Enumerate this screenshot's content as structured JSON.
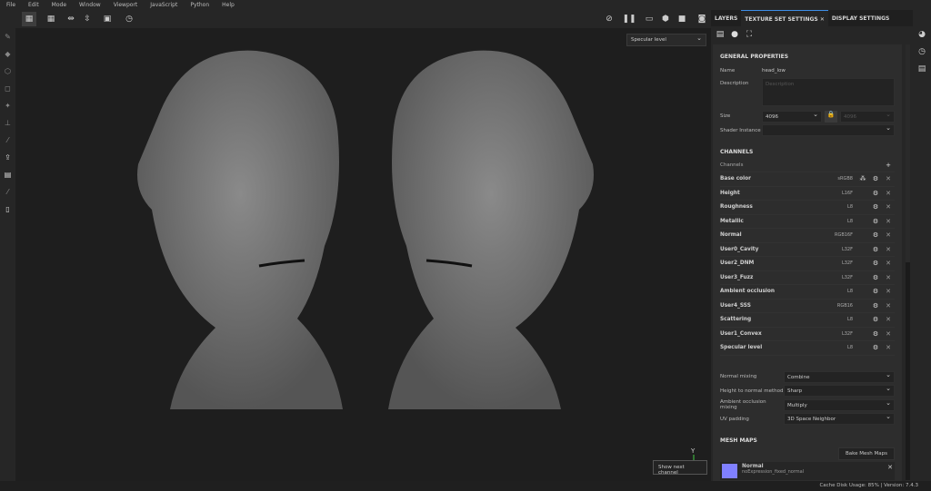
{
  "menu": [
    "File",
    "Edit",
    "Mode",
    "Window",
    "Viewport",
    "JavaScript",
    "Python",
    "Help"
  ],
  "viewport": {
    "channel_select": "Specular level",
    "tooltip": "Show next channel",
    "axis_label": "Y"
  },
  "tabs": {
    "layers": "LAYERS",
    "texture_set": "TEXTURE SET SETTINGS",
    "display": "DISPLAY SETTINGS"
  },
  "general": {
    "title": "GENERAL PROPERTIES",
    "name_label": "Name",
    "name": "head_low",
    "description_label": "Description",
    "description_placeholder": "Description",
    "size_label": "Size",
    "size": "4096",
    "size2": "4096",
    "shader_label": "Shader Instance"
  },
  "channels": {
    "title": "CHANNELS",
    "header": "Channels",
    "items": [
      {
        "name": "Base color",
        "format": "sRGB8"
      },
      {
        "name": "Height",
        "format": "L16F"
      },
      {
        "name": "Roughness",
        "format": "L8"
      },
      {
        "name": "Metallic",
        "format": "L8"
      },
      {
        "name": "Normal",
        "format": "RGB16F"
      },
      {
        "name": "User0_Cavity",
        "format": "L32F"
      },
      {
        "name": "User2_DNM",
        "format": "L32F"
      },
      {
        "name": "User3_Fuzz",
        "format": "L32F"
      },
      {
        "name": "Ambient occlusion",
        "format": "L8"
      },
      {
        "name": "User4_SSS",
        "format": "RGB16"
      },
      {
        "name": "Scattering",
        "format": "L8"
      },
      {
        "name": "User1_Convex",
        "format": "L32F"
      },
      {
        "name": "Specular level",
        "format": "L8"
      }
    ]
  },
  "mixing": [
    {
      "label": "Normal mixing",
      "value": "Combine"
    },
    {
      "label": "Height to normal method",
      "value": "Sharp"
    },
    {
      "label": "Ambient occlusion mixing",
      "value": "Multiply"
    },
    {
      "label": "UV padding",
      "value": "3D Space Neighbor"
    }
  ],
  "mesh_maps": {
    "title": "MESH MAPS",
    "bake": "Bake Mesh Maps",
    "item_name": "Normal",
    "item_file": "noExpression_fixed_normal",
    "item_color": "#8080ff"
  },
  "status": "Cache Disk Usage:   85% | Version: 7.4.3"
}
